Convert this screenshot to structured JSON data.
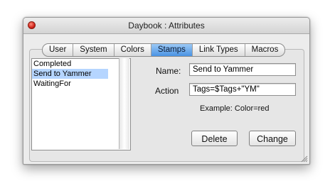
{
  "window": {
    "title": "Daybook : Attributes"
  },
  "tabs": [
    {
      "label": "User"
    },
    {
      "label": "System"
    },
    {
      "label": "Colors"
    },
    {
      "label": "Stamps"
    },
    {
      "label": "Link Types"
    },
    {
      "label": "Macros"
    }
  ],
  "active_tab": "Stamps",
  "stamps_list": [
    {
      "label": "Completed",
      "selected": false
    },
    {
      "label": "Send to Yammer",
      "selected": true
    },
    {
      "label": "WaitingFor",
      "selected": false
    }
  ],
  "form": {
    "name_label": "Name:",
    "name_value": "Send to Yammer",
    "action_label": "Action",
    "action_value": "Tags=$Tags+\"YM\"",
    "example_text": "Example: Color=red"
  },
  "buttons": {
    "delete_label": "Delete",
    "change_label": "Change"
  },
  "colors": {
    "selection": "#b5d5ff",
    "active_tab": "#4a93e3",
    "close_button": "#d0231a"
  },
  "icons": {
    "close": "close-icon",
    "resize": "resize-grip-icon"
  }
}
